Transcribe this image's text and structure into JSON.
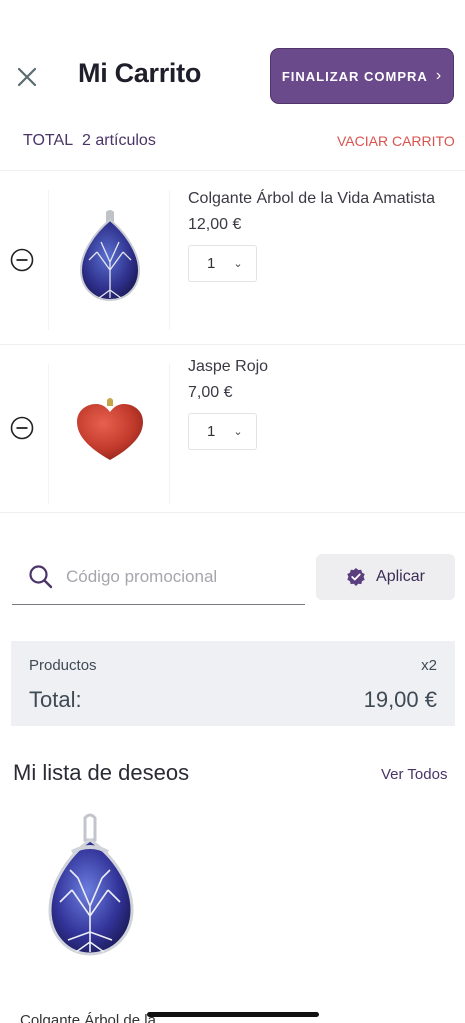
{
  "header": {
    "title": "Mi Carrito",
    "checkout_label": "FINALIZAR COMPRA",
    "close_icon": "close-icon",
    "chevron_icon": "chevron-right-icon"
  },
  "summary_bar": {
    "total_label": "TOTAL",
    "item_count": "2 artículos",
    "empty_cart_label": "VACIAR CARRITO"
  },
  "cart": {
    "items": [
      {
        "name": "Colgante Árbol de la Vida Amatista",
        "price": "12,00 €",
        "quantity": "1",
        "image": "amethyst-tree-of-life-pendant"
      },
      {
        "name": "Jaspe Rojo",
        "price": "7,00 €",
        "quantity": "1",
        "image": "red-jasper-heart"
      }
    ]
  },
  "promo": {
    "placeholder": "Código promocional",
    "value": "",
    "apply_label": "Aplicar"
  },
  "order_summary": {
    "products_label": "Productos",
    "products_count": "x2",
    "total_label": "Total:",
    "total_value": "19,00 €"
  },
  "wishlist": {
    "title": "Mi lista de deseos",
    "see_all_label": "Ver Todos",
    "items": [
      {
        "name": "Colgante Árbol de la",
        "image": "amethyst-tree-of-life-pendant"
      }
    ]
  },
  "colors": {
    "brand_purple": "#6b4a8c",
    "danger": "#d9534f",
    "summary_bg": "#eef0f3"
  }
}
